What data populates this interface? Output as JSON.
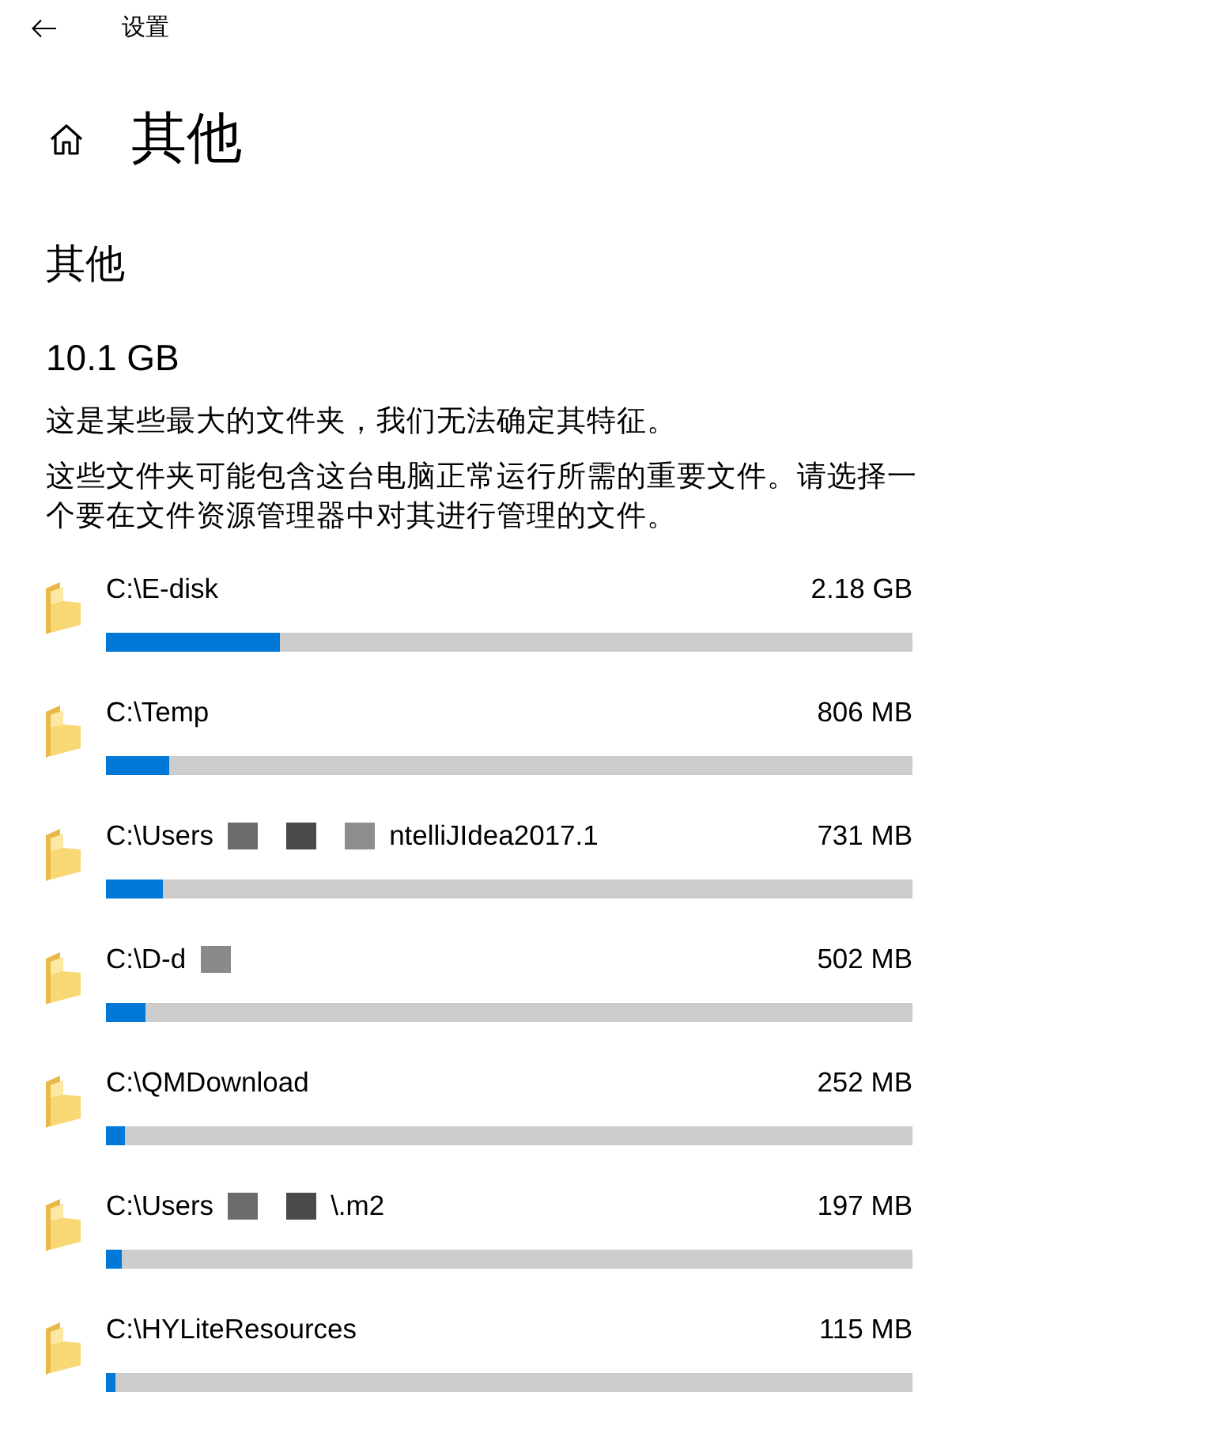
{
  "header": {
    "title": "设置"
  },
  "page": {
    "title": "其他"
  },
  "section": {
    "heading": "其他",
    "total": "10.1 GB",
    "description": "这是某些最大的文件夹，我们无法确定其特征。",
    "note": "这些文件夹可能包含这台电脑正常运行所需的重要文件。请选择一个要在文件资源管理器中对其进行管理的文件。"
  },
  "folders": [
    {
      "path": [
        {
          "kind": "text",
          "text": "C:\\E-disk"
        }
      ],
      "size": "2.18 GB",
      "level": 0.216
    },
    {
      "path": [
        {
          "kind": "text",
          "text": "C:\\Temp"
        }
      ],
      "size": "806 MB",
      "level": 0.078
    },
    {
      "path": [
        {
          "kind": "text",
          "text": "C:\\Users"
        },
        {
          "kind": "mask",
          "color": "#6b6b6b"
        },
        {
          "kind": "mask",
          "color": "#4a4a4a"
        },
        {
          "kind": "mask",
          "color": "#8e8e8e"
        },
        {
          "kind": "text",
          "text": "ntelliJIdea2017.1"
        }
      ],
      "size": "731 MB",
      "level": 0.071
    },
    {
      "path": [
        {
          "kind": "text",
          "text": "C:\\D-d"
        },
        {
          "kind": "mask",
          "color": "#8a8a8a"
        }
      ],
      "size": "502 MB",
      "level": 0.049
    },
    {
      "path": [
        {
          "kind": "text",
          "text": "C:\\QMDownload"
        }
      ],
      "size": "252 MB",
      "level": 0.024
    },
    {
      "path": [
        {
          "kind": "text",
          "text": "C:\\Users"
        },
        {
          "kind": "mask",
          "color": "#6b6b6b"
        },
        {
          "kind": "mask",
          "color": "#4a4a4a"
        },
        {
          "kind": "text",
          "text": "\\.m2"
        }
      ],
      "size": "197 MB",
      "level": 0.019
    },
    {
      "path": [
        {
          "kind": "text",
          "text": "C:\\HYLiteResources"
        }
      ],
      "size": "115 MB",
      "level": 0.011
    }
  ]
}
